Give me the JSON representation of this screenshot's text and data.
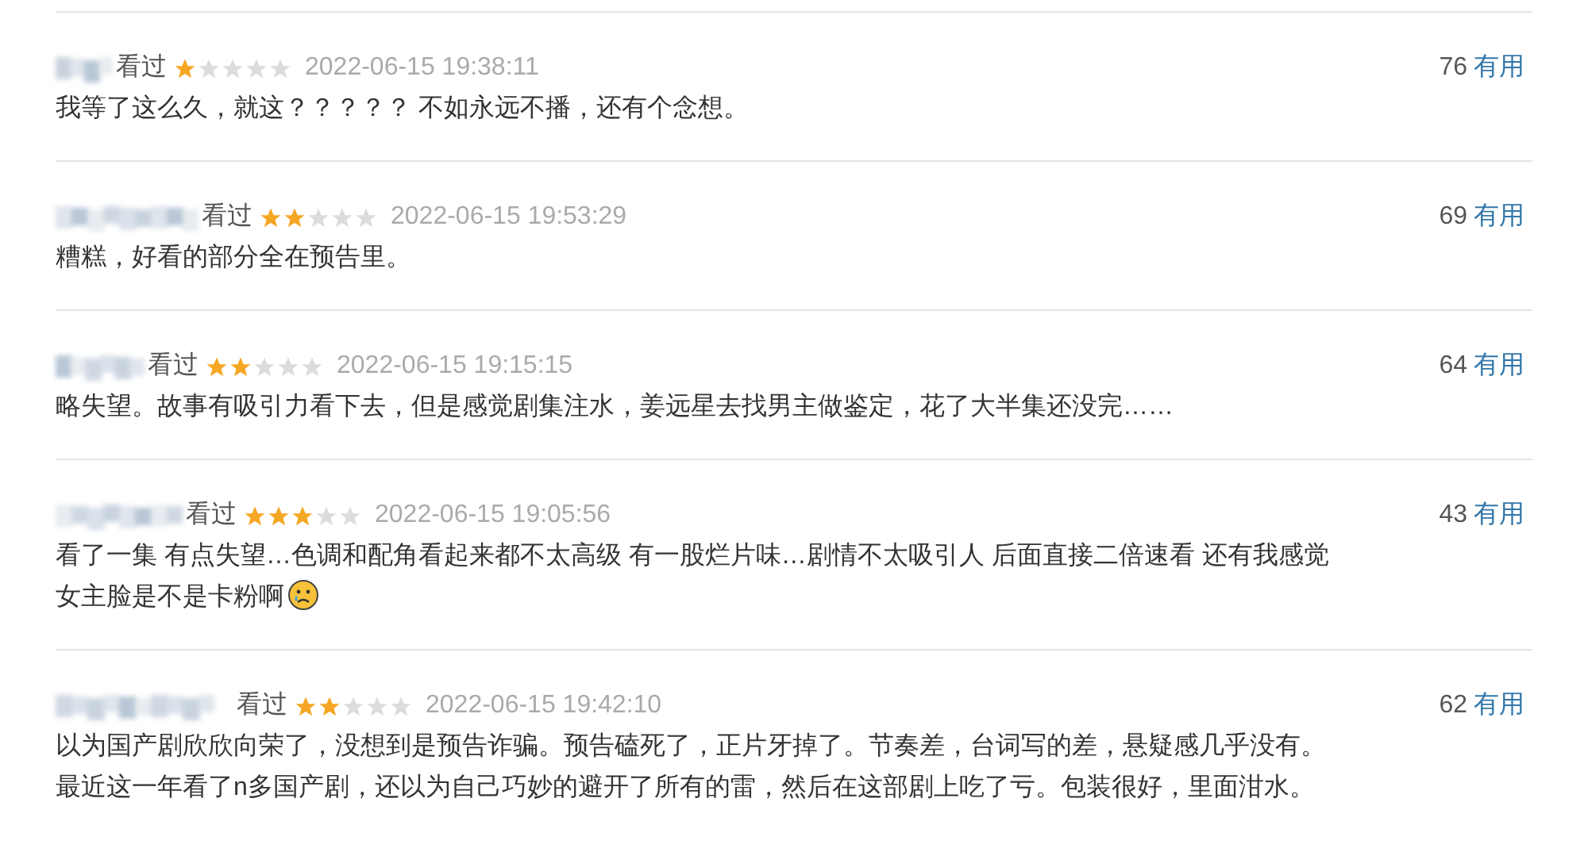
{
  "reviews": [
    {
      "status": "看过",
      "stars": 1,
      "time": "2022-06-15 19:38:11",
      "votes": "76",
      "vote_label": "有用",
      "lines": [
        "我等了这么久，就这？？？？？ 不如永远不播，还有个念想。"
      ]
    },
    {
      "status": "看过",
      "stars": 2,
      "time": "2022-06-15 19:53:29",
      "votes": "69",
      "vote_label": "有用",
      "lines": [
        "糟糕，好看的部分全在预告里。"
      ]
    },
    {
      "status": "看过",
      "stars": 2,
      "time": "2022-06-15 19:15:15",
      "votes": "64",
      "vote_label": "有用",
      "lines": [
        "略失望。故事有吸引力看下去，但是感觉剧集注水，姜远星去找男主做鉴定，花了大半集还没完……"
      ]
    },
    {
      "status": "看过",
      "stars": 3,
      "time": "2022-06-15 19:05:56",
      "votes": "43",
      "vote_label": "有用",
      "lines": [
        "看了一集 有点失望…色调和配角看起来都不太高级 有一股烂片味…剧情不太吸引人 后面直接二倍速看 还有我感觉",
        "女主脸是不是卡粉啊"
      ],
      "crying_emoji": true
    },
    {
      "status": "看过",
      "stars": 2,
      "time": "2022-06-15 19:42:10",
      "votes": "62",
      "vote_label": "有用",
      "lines": [
        "以为国产剧欣欣向荣了，没想到是预告诈骗。预告磕死了，正片牙掉了。节奏差，台词写的差，悬疑感几乎没有。",
        "最近这一年看了n多国产剧，还以为自己巧妙的避开了所有的雷，然后在这部剧上吃了亏。包装很好，里面泔水。"
      ]
    }
  ]
}
